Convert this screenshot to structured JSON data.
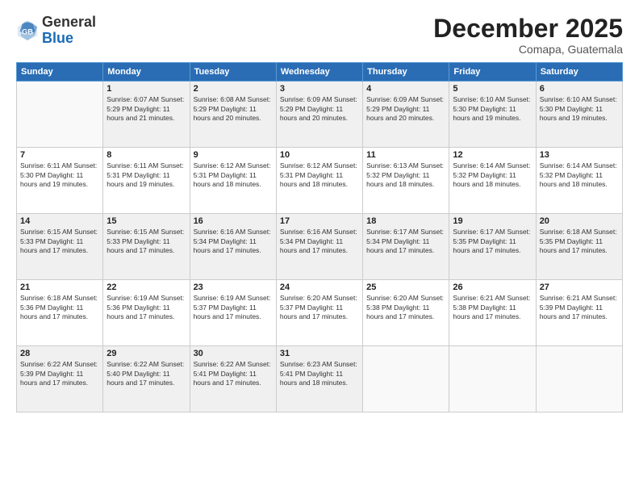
{
  "header": {
    "logo_general": "General",
    "logo_blue": "Blue",
    "month_title": "December 2025",
    "location": "Comapa, Guatemala"
  },
  "weekdays": [
    "Sunday",
    "Monday",
    "Tuesday",
    "Wednesday",
    "Thursday",
    "Friday",
    "Saturday"
  ],
  "weeks": [
    [
      {
        "day": "",
        "info": ""
      },
      {
        "day": "1",
        "info": "Sunrise: 6:07 AM\nSunset: 5:29 PM\nDaylight: 11 hours\nand 21 minutes."
      },
      {
        "day": "2",
        "info": "Sunrise: 6:08 AM\nSunset: 5:29 PM\nDaylight: 11 hours\nand 20 minutes."
      },
      {
        "day": "3",
        "info": "Sunrise: 6:09 AM\nSunset: 5:29 PM\nDaylight: 11 hours\nand 20 minutes."
      },
      {
        "day": "4",
        "info": "Sunrise: 6:09 AM\nSunset: 5:29 PM\nDaylight: 11 hours\nand 20 minutes."
      },
      {
        "day": "5",
        "info": "Sunrise: 6:10 AM\nSunset: 5:30 PM\nDaylight: 11 hours\nand 19 minutes."
      },
      {
        "day": "6",
        "info": "Sunrise: 6:10 AM\nSunset: 5:30 PM\nDaylight: 11 hours\nand 19 minutes."
      }
    ],
    [
      {
        "day": "7",
        "info": "Sunrise: 6:11 AM\nSunset: 5:30 PM\nDaylight: 11 hours\nand 19 minutes."
      },
      {
        "day": "8",
        "info": "Sunrise: 6:11 AM\nSunset: 5:31 PM\nDaylight: 11 hours\nand 19 minutes."
      },
      {
        "day": "9",
        "info": "Sunrise: 6:12 AM\nSunset: 5:31 PM\nDaylight: 11 hours\nand 18 minutes."
      },
      {
        "day": "10",
        "info": "Sunrise: 6:12 AM\nSunset: 5:31 PM\nDaylight: 11 hours\nand 18 minutes."
      },
      {
        "day": "11",
        "info": "Sunrise: 6:13 AM\nSunset: 5:32 PM\nDaylight: 11 hours\nand 18 minutes."
      },
      {
        "day": "12",
        "info": "Sunrise: 6:14 AM\nSunset: 5:32 PM\nDaylight: 11 hours\nand 18 minutes."
      },
      {
        "day": "13",
        "info": "Sunrise: 6:14 AM\nSunset: 5:32 PM\nDaylight: 11 hours\nand 18 minutes."
      }
    ],
    [
      {
        "day": "14",
        "info": "Sunrise: 6:15 AM\nSunset: 5:33 PM\nDaylight: 11 hours\nand 17 minutes."
      },
      {
        "day": "15",
        "info": "Sunrise: 6:15 AM\nSunset: 5:33 PM\nDaylight: 11 hours\nand 17 minutes."
      },
      {
        "day": "16",
        "info": "Sunrise: 6:16 AM\nSunset: 5:34 PM\nDaylight: 11 hours\nand 17 minutes."
      },
      {
        "day": "17",
        "info": "Sunrise: 6:16 AM\nSunset: 5:34 PM\nDaylight: 11 hours\nand 17 minutes."
      },
      {
        "day": "18",
        "info": "Sunrise: 6:17 AM\nSunset: 5:34 PM\nDaylight: 11 hours\nand 17 minutes."
      },
      {
        "day": "19",
        "info": "Sunrise: 6:17 AM\nSunset: 5:35 PM\nDaylight: 11 hours\nand 17 minutes."
      },
      {
        "day": "20",
        "info": "Sunrise: 6:18 AM\nSunset: 5:35 PM\nDaylight: 11 hours\nand 17 minutes."
      }
    ],
    [
      {
        "day": "21",
        "info": "Sunrise: 6:18 AM\nSunset: 5:36 PM\nDaylight: 11 hours\nand 17 minutes."
      },
      {
        "day": "22",
        "info": "Sunrise: 6:19 AM\nSunset: 5:36 PM\nDaylight: 11 hours\nand 17 minutes."
      },
      {
        "day": "23",
        "info": "Sunrise: 6:19 AM\nSunset: 5:37 PM\nDaylight: 11 hours\nand 17 minutes."
      },
      {
        "day": "24",
        "info": "Sunrise: 6:20 AM\nSunset: 5:37 PM\nDaylight: 11 hours\nand 17 minutes."
      },
      {
        "day": "25",
        "info": "Sunrise: 6:20 AM\nSunset: 5:38 PM\nDaylight: 11 hours\nand 17 minutes."
      },
      {
        "day": "26",
        "info": "Sunrise: 6:21 AM\nSunset: 5:38 PM\nDaylight: 11 hours\nand 17 minutes."
      },
      {
        "day": "27",
        "info": "Sunrise: 6:21 AM\nSunset: 5:39 PM\nDaylight: 11 hours\nand 17 minutes."
      }
    ],
    [
      {
        "day": "28",
        "info": "Sunrise: 6:22 AM\nSunset: 5:39 PM\nDaylight: 11 hours\nand 17 minutes."
      },
      {
        "day": "29",
        "info": "Sunrise: 6:22 AM\nSunset: 5:40 PM\nDaylight: 11 hours\nand 17 minutes."
      },
      {
        "day": "30",
        "info": "Sunrise: 6:22 AM\nSunset: 5:41 PM\nDaylight: 11 hours\nand 17 minutes."
      },
      {
        "day": "31",
        "info": "Sunrise: 6:23 AM\nSunset: 5:41 PM\nDaylight: 11 hours\nand 18 minutes."
      },
      {
        "day": "",
        "info": ""
      },
      {
        "day": "",
        "info": ""
      },
      {
        "day": "",
        "info": ""
      }
    ]
  ]
}
